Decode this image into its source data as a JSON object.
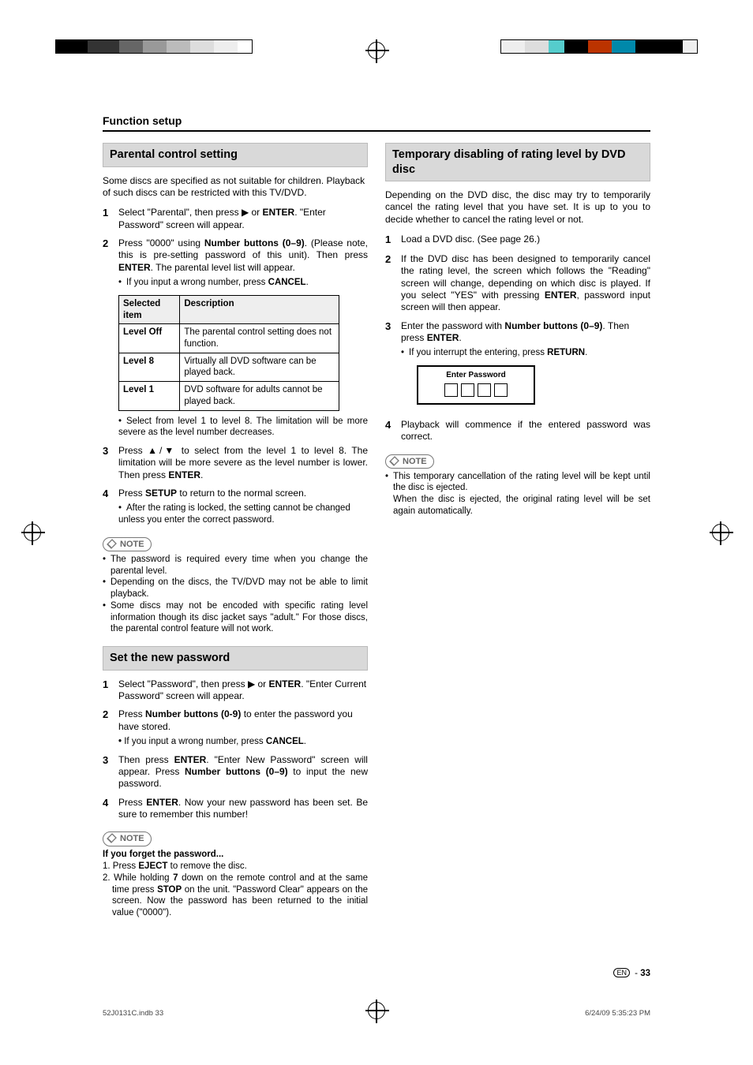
{
  "header": {
    "function_setup": "Function setup"
  },
  "left": {
    "sec1_title": "Parental control setting",
    "intro": "Some discs are specified as not suitable for children. Playback of such discs can be restricted with this TV/DVD.",
    "step1_a": "Select \"Parental\", then press ",
    "step1_b": " or ",
    "step1_enter": "ENTER",
    "step1_c": ". \"Enter Password\" screen will appear.",
    "step2_a": "Press \"0000\" using ",
    "step2_btns": "Number buttons (0–9)",
    "step2_b": ". (Please note, this is pre-setting password of this unit). Then press ",
    "step2_enter": "ENTER",
    "step2_c": ". The parental level list will appear.",
    "step2_sub_a": "If you input a wrong number, press ",
    "step2_sub_cancel": "CANCEL",
    "step2_sub_b": ".",
    "table": {
      "h1": "Selected item",
      "h2": "Description",
      "r1c1": "Level Off",
      "r1c2": "The parental control setting does not function.",
      "r2c1": "Level 8",
      "r2c2": "Virtually all DVD software can be played back.",
      "r3c1": "Level 1",
      "r3c2": "DVD software for adults cannot be played back."
    },
    "table_note": "Select from level 1 to level 8. The limitation will be more severe as the level number decreases.",
    "step3_a": "Press ▲/▼ to select from the level 1 to level 8. The limitation will be more severe as the level number is lower. Then press ",
    "step3_enter": "ENTER",
    "step3_b": ".",
    "step4_a": "Press ",
    "step4_setup": "SETUP",
    "step4_b": " to return to the normal screen.",
    "step4_sub": "After the rating is locked, the setting cannot be changed unless you enter the correct password.",
    "note_label": "NOTE",
    "notes1": [
      "The password is required every time when you change the parental level.",
      "Depending on the discs, the TV/DVD may not be able to limit playback.",
      "Some discs may not be encoded with specific rating level information though its disc jacket says \"adult.\" For those discs, the parental control feature will not work."
    ],
    "sec2_title": "Set the new password",
    "p_step1_a": "Select \"Password\", then press ",
    "p_step1_b": " or ",
    "p_step1_enter": "ENTER",
    "p_step1_c": ". \"Enter Current Password\" screen will appear.",
    "p_step2_a": "Press ",
    "p_step2_btns": "Number buttons (0-9)",
    "p_step2_b": " to enter the password you have stored.",
    "p_step2_sub_a": "If you input a wrong number, press ",
    "p_step2_sub_cancel": "CANCEL",
    "p_step2_sub_b": ".",
    "p_step3_a": "Then press ",
    "p_step3_enter": "ENTER",
    "p_step3_b": ". \"Enter New Password\" screen will appear. Press ",
    "p_step3_btns": "Number buttons (0–9)",
    "p_step3_c": " to input the new password.",
    "p_step4_a": "Press ",
    "p_step4_enter": "ENTER",
    "p_step4_b": ". Now your new password has been set. Be sure to remember this number!",
    "forget_heading": "If you forget the password...",
    "forget1_a": "1. Press ",
    "forget1_eject": "EJECT",
    "forget1_b": " to remove the disc.",
    "forget2_a": "2. While holding ",
    "forget2_7": "7",
    "forget2_b": " down on the remote control and at the same time press ",
    "forget2_stop": "STOP",
    "forget2_c": " on the unit. \"Password Clear\" appears on the screen. Now the password has been returned to the initial value (\"0000\")."
  },
  "right": {
    "sec_title": "Temporary disabling of rating level by DVD disc",
    "intro": "Depending on the DVD disc, the disc may try to temporarily cancel the rating level that you have set. It is up to you to decide whether to cancel the rating level or not.",
    "step1": "Load a DVD disc. (See page 26.)",
    "step2_a": "If the DVD disc has been designed to temporarily cancel the rating level, the screen which follows the \"Reading\" screen will change, depending on which disc is played. If you select \"YES\" with pressing ",
    "step2_enter": "ENTER",
    "step2_b": ", password input screen will then appear.",
    "step3_a": "Enter the password with ",
    "step3_btns": "Number buttons (0–9)",
    "step3_b": ". Then press ",
    "step3_enter": "ENTER",
    "step3_c": ".",
    "step3_sub_a": "If you interrupt the entering, press ",
    "step3_sub_return": "RETURN",
    "step3_sub_b": ".",
    "pw_title": "Enter Password",
    "step4": "Playback will commence if the entered password was correct.",
    "note_label": "NOTE",
    "note1": "This temporary cancellation of the rating level will be kept until the disc is ejected.",
    "note2": "When the disc is ejected, the original rating level will be set again automatically."
  },
  "footer": {
    "lang": "EN",
    "sep": " - ",
    "page": "33"
  },
  "printfoot": {
    "left": "52J0131C.indb   33",
    "right": "6/24/09   5:35:23 PM"
  }
}
